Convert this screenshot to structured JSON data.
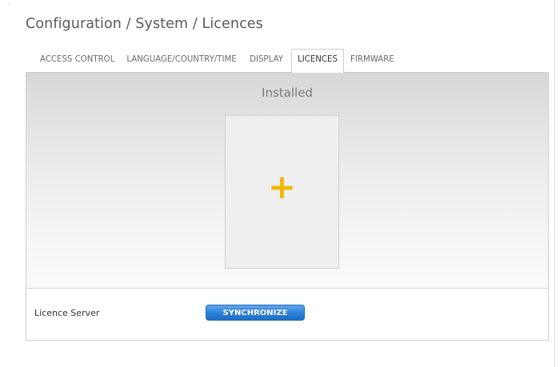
{
  "page": {
    "title": "Configuration / System / Licences"
  },
  "tabs": [
    {
      "label": "ACCESS CONTROL",
      "active": false
    },
    {
      "label": "LANGUAGE/COUNTRY/TIME",
      "active": false
    },
    {
      "label": "DISPLAY",
      "active": false
    },
    {
      "label": "LICENCES",
      "active": true
    },
    {
      "label": "FIRMWARE",
      "active": false
    }
  ],
  "installed": {
    "heading": "Installed",
    "add_tile_icon": "plus-icon",
    "accent_color": "#f2b705"
  },
  "licence_server": {
    "label": "Licence Server",
    "sync_button": "SYNCHRONIZE",
    "button_color": "#2a7fd7"
  }
}
